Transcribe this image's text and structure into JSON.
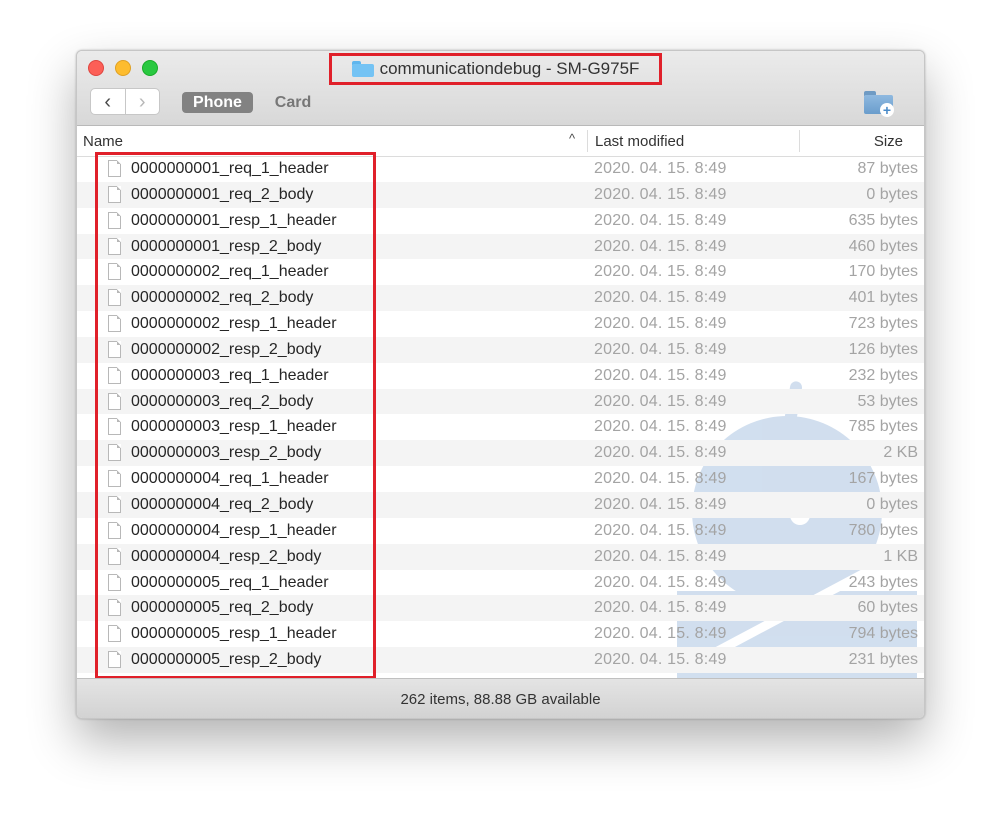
{
  "window": {
    "title": "communicationdebug - SM-G975F"
  },
  "toolbar": {
    "back_glyph": "‹",
    "forward_glyph": "›",
    "tabs": [
      "Phone",
      "Card"
    ],
    "active_tab": "Phone",
    "new_folder_icon": "new-folder-icon"
  },
  "columns": {
    "name": "Name",
    "sort_indicator": "^",
    "modified": "Last modified",
    "size": "Size"
  },
  "files": [
    {
      "name": "0000000001_req_1_header",
      "modified": "2020. 04. 15. 8:49",
      "size": "87 bytes"
    },
    {
      "name": "0000000001_req_2_body",
      "modified": "2020. 04. 15. 8:49",
      "size": "0 bytes"
    },
    {
      "name": "0000000001_resp_1_header",
      "modified": "2020. 04. 15. 8:49",
      "size": "635 bytes"
    },
    {
      "name": "0000000001_resp_2_body",
      "modified": "2020. 04. 15. 8:49",
      "size": "460 bytes"
    },
    {
      "name": "0000000002_req_1_header",
      "modified": "2020. 04. 15. 8:49",
      "size": "170 bytes"
    },
    {
      "name": "0000000002_req_2_body",
      "modified": "2020. 04. 15. 8:49",
      "size": "401 bytes"
    },
    {
      "name": "0000000002_resp_1_header",
      "modified": "2020. 04. 15. 8:49",
      "size": "723 bytes"
    },
    {
      "name": "0000000002_resp_2_body",
      "modified": "2020. 04. 15. 8:49",
      "size": "126 bytes"
    },
    {
      "name": "0000000003_req_1_header",
      "modified": "2020. 04. 15. 8:49",
      "size": "232 bytes"
    },
    {
      "name": "0000000003_req_2_body",
      "modified": "2020. 04. 15. 8:49",
      "size": "53 bytes"
    },
    {
      "name": "0000000003_resp_1_header",
      "modified": "2020. 04. 15. 8:49",
      "size": "785 bytes"
    },
    {
      "name": "0000000003_resp_2_body",
      "modified": "2020. 04. 15. 8:49",
      "size": "2 KB"
    },
    {
      "name": "0000000004_req_1_header",
      "modified": "2020. 04. 15. 8:49",
      "size": "167 bytes"
    },
    {
      "name": "0000000004_req_2_body",
      "modified": "2020. 04. 15. 8:49",
      "size": "0 bytes"
    },
    {
      "name": "0000000004_resp_1_header",
      "modified": "2020. 04. 15. 8:49",
      "size": "780 bytes"
    },
    {
      "name": "0000000004_resp_2_body",
      "modified": "2020. 04. 15. 8:49",
      "size": "1 KB"
    },
    {
      "name": "0000000005_req_1_header",
      "modified": "2020. 04. 15. 8:49",
      "size": "243 bytes"
    },
    {
      "name": "0000000005_req_2_body",
      "modified": "2020. 04. 15. 8:49",
      "size": "60 bytes"
    },
    {
      "name": "0000000005_resp_1_header",
      "modified": "2020. 04. 15. 8:49",
      "size": "794 bytes"
    },
    {
      "name": "0000000005_resp_2_body",
      "modified": "2020. 04. 15. 8:49",
      "size": "231 bytes"
    }
  ],
  "status": {
    "text": "262 items, 88.88 GB available"
  },
  "colors": {
    "highlight_border": "#e0202a",
    "watermark": "#c9d9ec",
    "folder": "#74c3f4"
  },
  "icons": {
    "folder": "folder-icon",
    "file": "file-icon",
    "watermark": "android-robot-icon"
  }
}
